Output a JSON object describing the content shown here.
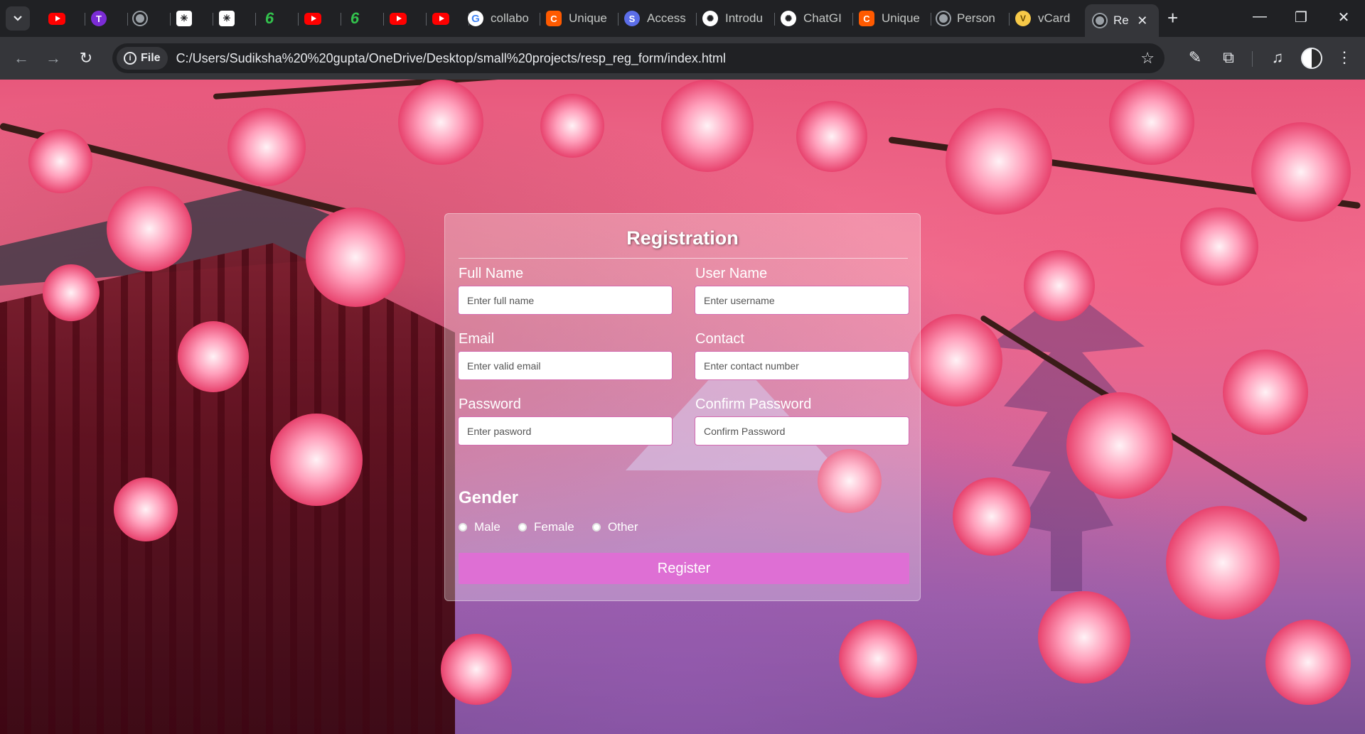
{
  "browser": {
    "tabs": [
      {
        "favicon": "youtube-icon",
        "title": ""
      },
      {
        "favicon": "tor-icon",
        "title": ""
      },
      {
        "favicon": "globe-icon",
        "title": ""
      },
      {
        "favicon": "ai-icon",
        "title": ""
      },
      {
        "favicon": "ai-icon",
        "title": ""
      },
      {
        "favicon": "six-icon",
        "title": ""
      },
      {
        "favicon": "youtube-icon",
        "title": ""
      },
      {
        "favicon": "six-icon",
        "title": ""
      },
      {
        "favicon": "youtube-icon",
        "title": ""
      },
      {
        "favicon": "youtube-icon",
        "title": ""
      },
      {
        "favicon": "google-icon",
        "title": "collabo"
      },
      {
        "favicon": "c-icon",
        "title": "Unique"
      },
      {
        "favicon": "s-icon",
        "title": "Access"
      },
      {
        "favicon": "openai-icon",
        "title": "Introdu"
      },
      {
        "favicon": "openai-icon",
        "title": "ChatGI"
      },
      {
        "favicon": "c-icon",
        "title": "Unique"
      },
      {
        "favicon": "globe-icon",
        "title": "Person"
      },
      {
        "favicon": "vcard-icon",
        "title": "vCard"
      }
    ],
    "active_tab": {
      "favicon": "globe-icon",
      "title": "Re"
    },
    "address": {
      "chip_label": "File",
      "url": "C:/Users/Sudiksha%20%20gupta/OneDrive/Desktop/small%20projects/resp_reg_form/index.html"
    }
  },
  "form": {
    "title": "Registration",
    "fields": {
      "full_name": {
        "label": "Full Name",
        "placeholder": "Enter full name"
      },
      "user_name": {
        "label": "User Name",
        "placeholder": "Enter username"
      },
      "email": {
        "label": "Email",
        "placeholder": "Enter valid email"
      },
      "contact": {
        "label": "Contact",
        "placeholder": "Enter contact number"
      },
      "password": {
        "label": "Password",
        "placeholder": "Enter pasword"
      },
      "confirm_password": {
        "label": "Confirm Password",
        "placeholder": "Confirm Password"
      }
    },
    "gender": {
      "title": "Gender",
      "options": [
        "Male",
        "Female",
        "Other"
      ]
    },
    "submit_label": "Register"
  },
  "theme": {
    "button_color": "#de6fd4",
    "input_border": "#d36ab0"
  }
}
